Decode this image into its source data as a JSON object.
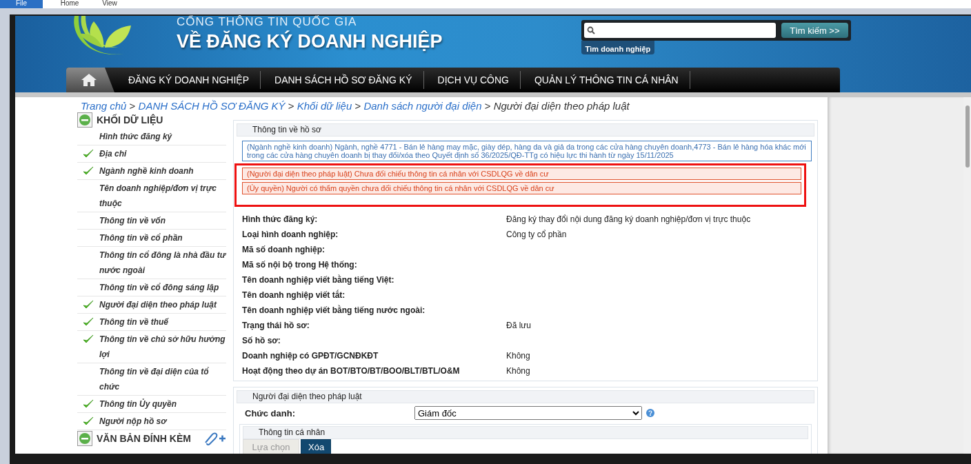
{
  "ribbon_tabs": [
    {
      "label": "File",
      "selected": true
    },
    {
      "label": "Home",
      "selected": false
    },
    {
      "label": "View",
      "selected": false
    }
  ],
  "header": {
    "title_top": "CỔNG THÔNG TIN QUỐC GIA",
    "title": "VỀ ĐĂNG KÝ DOANH NGHIỆP",
    "search": {
      "button": "Tìm kiếm >>",
      "tab": "Tìm doanh nghiệp"
    }
  },
  "nav": [
    "ĐĂNG KÝ DOANH NGHIỆP",
    "DANH SÁCH HỒ SƠ ĐĂNG KÝ",
    "DỊCH VỤ CÔNG",
    "QUẢN LÝ THÔNG TIN CÁ NHÂN"
  ],
  "breadcrumb": [
    {
      "kind": "link",
      "text": "Trang chủ"
    },
    {
      "kind": "separator",
      "text": ">"
    },
    {
      "kind": "link",
      "text": "DANH SÁCH HỒ SƠ ĐĂNG KÝ"
    },
    {
      "kind": "separator",
      "text": ">"
    },
    {
      "kind": "link",
      "text": "Khối dữ liệu"
    },
    {
      "kind": "separator",
      "text": ">"
    },
    {
      "kind": "link",
      "text": "Danh sách người đại diện"
    },
    {
      "kind": "separator",
      "text": ">"
    },
    {
      "kind": "current",
      "text": "Người đại diện theo pháp luật"
    }
  ],
  "sidebar": {
    "sections": [
      {
        "title": "KHỐI DỮ LIỆU",
        "items": [
          {
            "label": "Hình thức đăng ký",
            "checked": false
          },
          {
            "label": "Địa chỉ",
            "checked": true
          },
          {
            "label": "Ngành nghề kinh doanh",
            "checked": true
          },
          {
            "label": "Tên doanh nghiệp/đơn vị trực thuộc",
            "checked": false
          },
          {
            "label": "Thông tin về vốn",
            "checked": false
          },
          {
            "label": "Thông tin về cổ phần",
            "checked": false
          },
          {
            "label": "Thông tin cổ đông là nhà đầu tư nước ngoài",
            "checked": false
          },
          {
            "label": "Thông tin về cổ đông sáng lập",
            "checked": false
          },
          {
            "label": "Người đại diện theo pháp luật",
            "checked": true
          },
          {
            "label": "Thông tin về thuế",
            "checked": true
          },
          {
            "label": "Thông tin về chủ sở hữu hưởng lợi",
            "checked": true
          },
          {
            "label": "Thông tin về đại diện của tổ chức",
            "checked": false
          },
          {
            "label": "Thông tin Ủy quyền",
            "checked": true
          },
          {
            "label": "Người nộp hồ sơ",
            "checked": true
          }
        ]
      },
      {
        "title": "VĂN BẢN ĐÍNH KÈM"
      }
    ]
  },
  "record_panel": {
    "title": "Thông tin về hồ sơ",
    "notes": [
      {
        "kind": "info",
        "text": "(Ngành nghề kinh doanh) Ngành, nghề 4771 - Bán lẻ hàng may mặc, giày dép, hàng da và giả da trong các cửa hàng chuyên doanh,4773 - Bán lẻ hàng hóa khác mới trong các cửa hàng chuyên doanh bị thay đổi/xóa theo Quyết định số 36/2025/QĐ-TTg có hiệu lực thi hành từ ngày 15/11/2025"
      },
      {
        "kind": "error",
        "text": "(Người đại diện theo pháp luật) Chưa đối chiếu thông tin cá nhân với CSDLQG về dân cư"
      },
      {
        "kind": "error",
        "text": "(Ủy quyền) Người có thẩm quyền chưa đối chiếu thông tin cá nhân với CSDLQG về dân cư"
      }
    ],
    "fields": [
      {
        "label": "Hình thức đăng ký:",
        "value": "Đăng ký thay đổi nội dung đăng ký doanh nghiệp/đơn vị trực thuộc"
      },
      {
        "label": "Loại hình doanh nghiệp:",
        "value": "Công ty cổ phần"
      },
      {
        "label": "Mã số doanh nghiệp:"
      },
      {
        "label": "Mã số nội bộ trong Hệ thống:"
      },
      {
        "label": "Tên doanh nghiệp viết bằng tiếng Việt:"
      },
      {
        "label": "Tên doanh nghiệp viết tắt:"
      },
      {
        "label": "Tên doanh nghiệp viết bằng tiếng nước ngoài:"
      },
      {
        "label": "Trạng thái hồ sơ:",
        "value": "Đã lưu"
      },
      {
        "label": "Số hồ sơ:"
      },
      {
        "label": "Doanh nghiệp có GPĐT/GCNĐKĐT",
        "value": "Không"
      },
      {
        "label": "Hoạt động theo dự án BOT/BTO/BT/BOO/BLT/BTL/O&M",
        "value": "Không"
      }
    ]
  },
  "representative_panel": {
    "title": "Người đại diện theo pháp luật",
    "position_label": "Chức danh:",
    "position_value": "Giám đốc",
    "personal": {
      "title": "Thông tin cá nhân",
      "buttons": [
        {
          "label": "Lựa chọn",
          "disabled": true
        },
        {
          "label": "Xóa",
          "disabled": false
        }
      ]
    }
  }
}
